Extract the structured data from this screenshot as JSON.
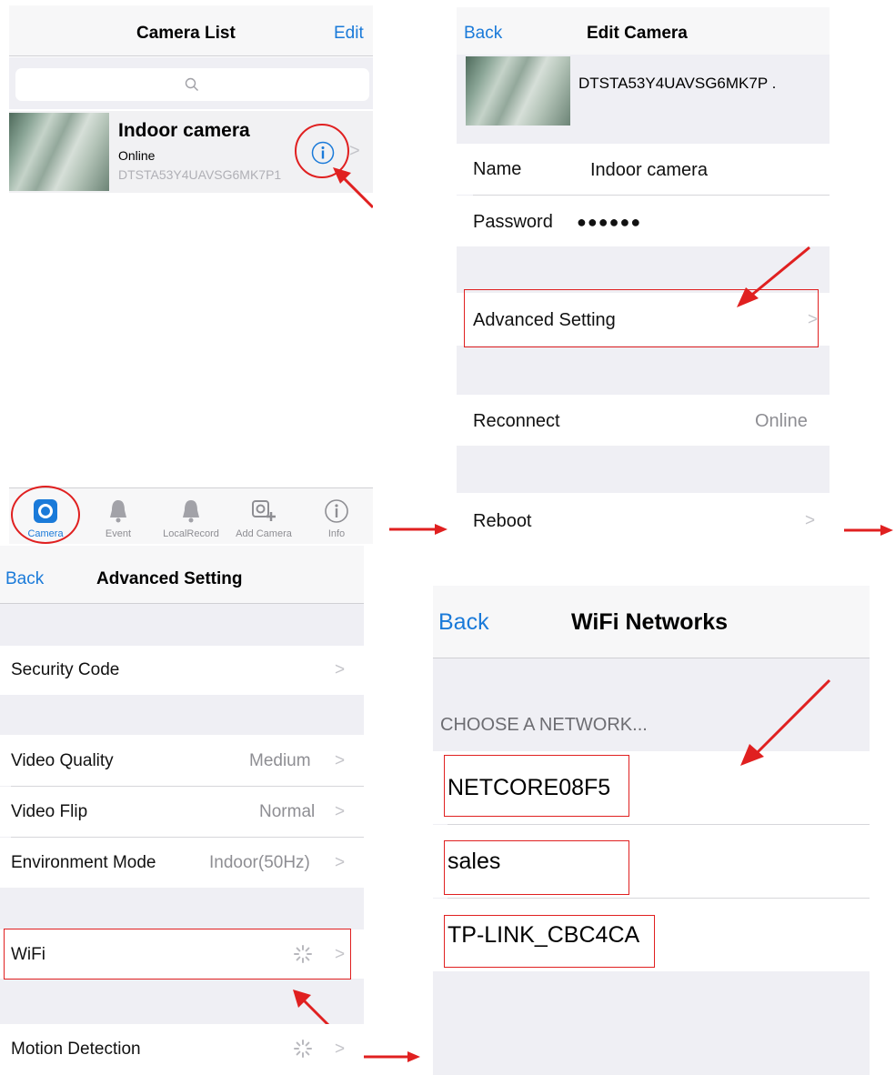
{
  "colors": {
    "accent": "#1a7ad9",
    "annotation_red": "#e02020",
    "group_background": "#efeff4"
  },
  "camera_list": {
    "title": "Camera List",
    "edit": "Edit",
    "search_icon": "search-icon",
    "camera": {
      "name": "Indoor camera",
      "status": "Online",
      "uid": "DTSTA53Y4UAVSG6MK7P1"
    },
    "tabs": [
      {
        "label": "Camera",
        "icon": "camera-icon"
      },
      {
        "label": "Event",
        "icon": "bell-icon"
      },
      {
        "label": "LocalRecord",
        "icon": "bell-icon"
      },
      {
        "label": "Add Camera",
        "icon": "add-camera-icon"
      },
      {
        "label": "Info",
        "icon": "info-icon"
      }
    ]
  },
  "edit_camera": {
    "back": "Back",
    "title": "Edit Camera",
    "uid": "DTSTA53Y4UAVSG6MK7P .",
    "name_label": "Name",
    "name_value": "Indoor camera",
    "password_label": "Password",
    "password_value": "●●●●●●",
    "advanced_setting": "Advanced Setting",
    "reconnect": "Reconnect",
    "reconnect_value": "Online",
    "reboot": "Reboot"
  },
  "advanced_setting": {
    "back": "Back",
    "title": "Advanced Setting",
    "security_code": "Security Code",
    "video_quality": "Video Quality",
    "video_quality_value": "Medium",
    "video_flip": "Video Flip",
    "video_flip_value": "Normal",
    "environment_mode": "Environment Mode",
    "environment_mode_value": "Indoor(50Hz)",
    "wifi": "WiFi",
    "motion_detection": "Motion Detection"
  },
  "wifi_networks": {
    "back": "Back",
    "title": "WiFi Networks",
    "section_header": "CHOOSE A NETWORK...",
    "networks": [
      "NETCORE08F5",
      "sales",
      "TP-LINK_CBC4CA"
    ]
  }
}
